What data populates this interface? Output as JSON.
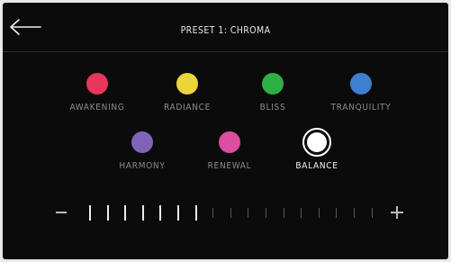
{
  "header": {
    "title": "PRESET 1: CHROMA",
    "back_icon": "arrow-left-icon"
  },
  "presets": [
    {
      "label": "AWAKENING",
      "color": "#e8365c",
      "selected": false
    },
    {
      "label": "RADIANCE",
      "color": "#ead53b",
      "selected": false
    },
    {
      "label": "BLISS",
      "color": "#2fb046",
      "selected": false
    },
    {
      "label": "TRANQUILITY",
      "color": "#3e7fd0",
      "selected": false
    },
    {
      "label": "HARMONY",
      "color": "#7f63b8",
      "selected": false
    },
    {
      "label": "RENEWAL",
      "color": "#dc4ea2",
      "selected": false
    },
    {
      "label": "BALANCE",
      "color": "#ffffff",
      "selected": true
    }
  ],
  "slider": {
    "level": 7,
    "total": 17,
    "minus_icon": "minus-icon",
    "plus_icon": "plus-icon"
  }
}
